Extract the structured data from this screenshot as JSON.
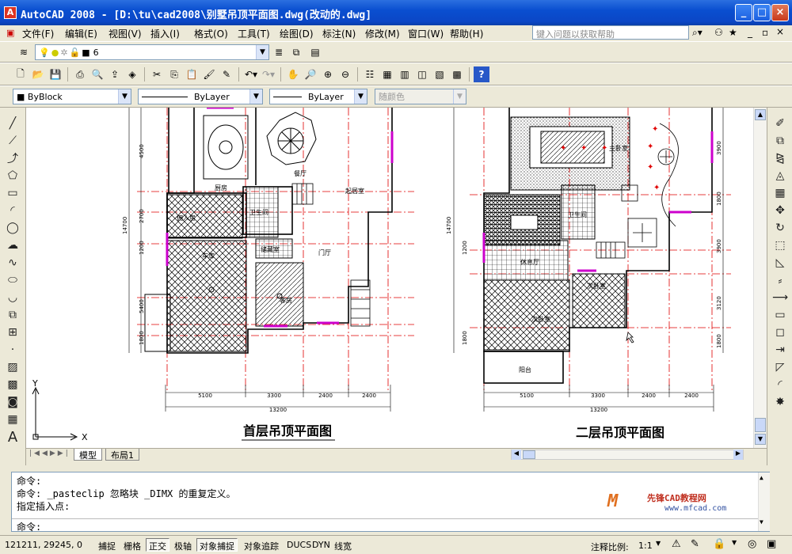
{
  "window": {
    "title": "AutoCAD 2008 - [D:\\tu\\cad2008\\别墅吊顶平面图.dwg(改动的.dwg]",
    "app_icon": "A"
  },
  "menu": [
    "文件(F)",
    "编辑(E)",
    "视图(V)",
    "插入(I)",
    "格式(O)",
    "工具(T)",
    "绘图(D)",
    "标注(N)",
    "修改(M)",
    "窗口(W)",
    "帮助(H)"
  ],
  "help_search": {
    "placeholder": "键入问题以获取帮助"
  },
  "layer_toolbar": {
    "current_layer": "6"
  },
  "properties": {
    "color": "ByBlock",
    "linetype": "ByLayer",
    "lineweight": "ByLayer",
    "plotstyle": "随颜色"
  },
  "drawing": {
    "plan1_title": "首层吊顶平面图",
    "plan2_title": "二层吊顶平面图",
    "plan1_rooms": [
      "厨房",
      "餐厅",
      "起居室",
      "佣人房",
      "卫生间",
      "储藏室",
      "门厅",
      "车库",
      "客房"
    ],
    "plan2_rooms": [
      "主卧室",
      "卫生间",
      "休息厅",
      "次卧室",
      "次卧室",
      "阳台"
    ],
    "plan1_dims_bottom": [
      "5100",
      "3300",
      "2400",
      "2400"
    ],
    "plan1_total": "13200",
    "plan2_dims_bottom": [
      "5100",
      "3300",
      "2400",
      "2400"
    ],
    "plan2_total": "13200",
    "plan1_dims_left": [
      "14700",
      "4500",
      "2700",
      "1200",
      "5400",
      "1800"
    ],
    "plan2_dims_left": [
      "14700",
      "1200",
      "1800"
    ],
    "plan2_dims_right": [
      "3900",
      "1800",
      "3900",
      "3120",
      "1800"
    ],
    "ucs": {
      "x": "X",
      "y": "Y"
    }
  },
  "tabs": [
    "模型",
    "布局1"
  ],
  "command": {
    "lines": [
      "命令:",
      "命令:  _pasteclip 忽略块 _DIMX 的重复定义。",
      "指定插入点:"
    ],
    "prompt": "命令:"
  },
  "watermark": {
    "line1": "先锋CAD教程网",
    "line2": "www.mfcad.com"
  },
  "status": {
    "coords": "121211, 29245, 0",
    "buttons": [
      {
        "label": "捕捉",
        "on": false
      },
      {
        "label": "栅格",
        "on": false
      },
      {
        "label": "正交",
        "on": true
      },
      {
        "label": "极轴",
        "on": false
      },
      {
        "label": "对象捕捉",
        "on": true
      },
      {
        "label": "对象追踪",
        "on": false
      },
      {
        "label": "DUCS",
        "on": false
      },
      {
        "label": "DYN",
        "on": false
      },
      {
        "label": "线宽",
        "on": false
      }
    ],
    "scale_label": "注释比例:",
    "scale_value": "1:1"
  },
  "colors": {
    "titlebar": "#0a4fd0",
    "red_grid": "#e00000",
    "magenta": "#cc00cc",
    "canvas": "#ffffff"
  }
}
